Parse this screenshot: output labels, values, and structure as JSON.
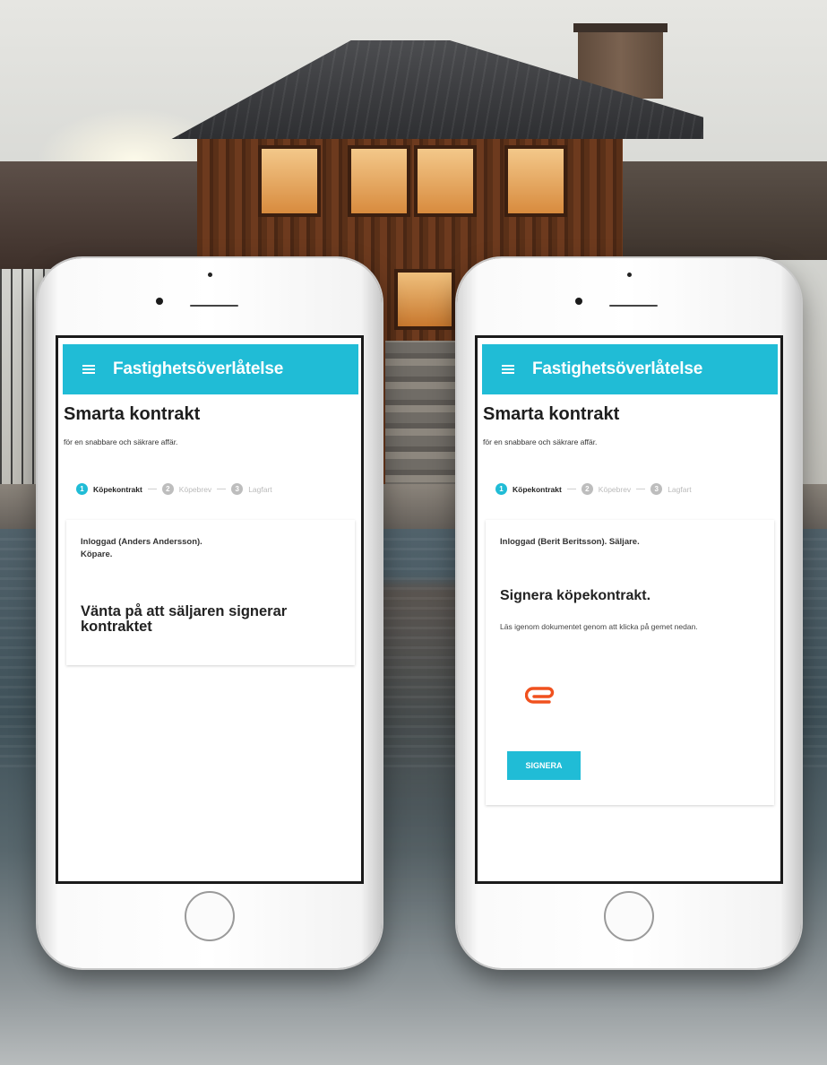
{
  "phones": [
    {
      "id": "buyer",
      "app_title": "Fastighetsöverlåtelse",
      "headline": "Smarta kontrakt",
      "subheadline": "för en snabbare och säkrare affär.",
      "steps": [
        {
          "number": "1",
          "label": "Köpekontrakt",
          "active": true
        },
        {
          "number": "2",
          "label": "Köpebrev",
          "active": false
        },
        {
          "number": "3",
          "label": "Lagfart",
          "active": false
        }
      ],
      "logged_in_text": "Inloggad (Anders Andersson).\nKöpare.",
      "wait_message": "Vänta på att säljaren signerar kontraktet"
    },
    {
      "id": "seller",
      "app_title": "Fastighetsöverlåtelse",
      "headline": "Smarta kontrakt",
      "subheadline": "för en snabbare och säkrare affär.",
      "steps": [
        {
          "number": "1",
          "label": "Köpekontrakt",
          "active": true
        },
        {
          "number": "2",
          "label": "Köpebrev",
          "active": false
        },
        {
          "number": "3",
          "label": "Lagfart",
          "active": false
        }
      ],
      "logged_in_text": "Inloggad (Berit Beritsson). Säljare.",
      "sign_title": "Signera köpekontrakt.",
      "sign_description": "Läs igenom dokumentet genom att klicka på gemet nedan.",
      "attachment_icon": "paperclip-icon",
      "sign_button_label": "SIGNERA"
    }
  ],
  "colors": {
    "accent": "#20bcd6",
    "attachment": "#f0511e",
    "step_inactive": "#bdbdbd"
  }
}
